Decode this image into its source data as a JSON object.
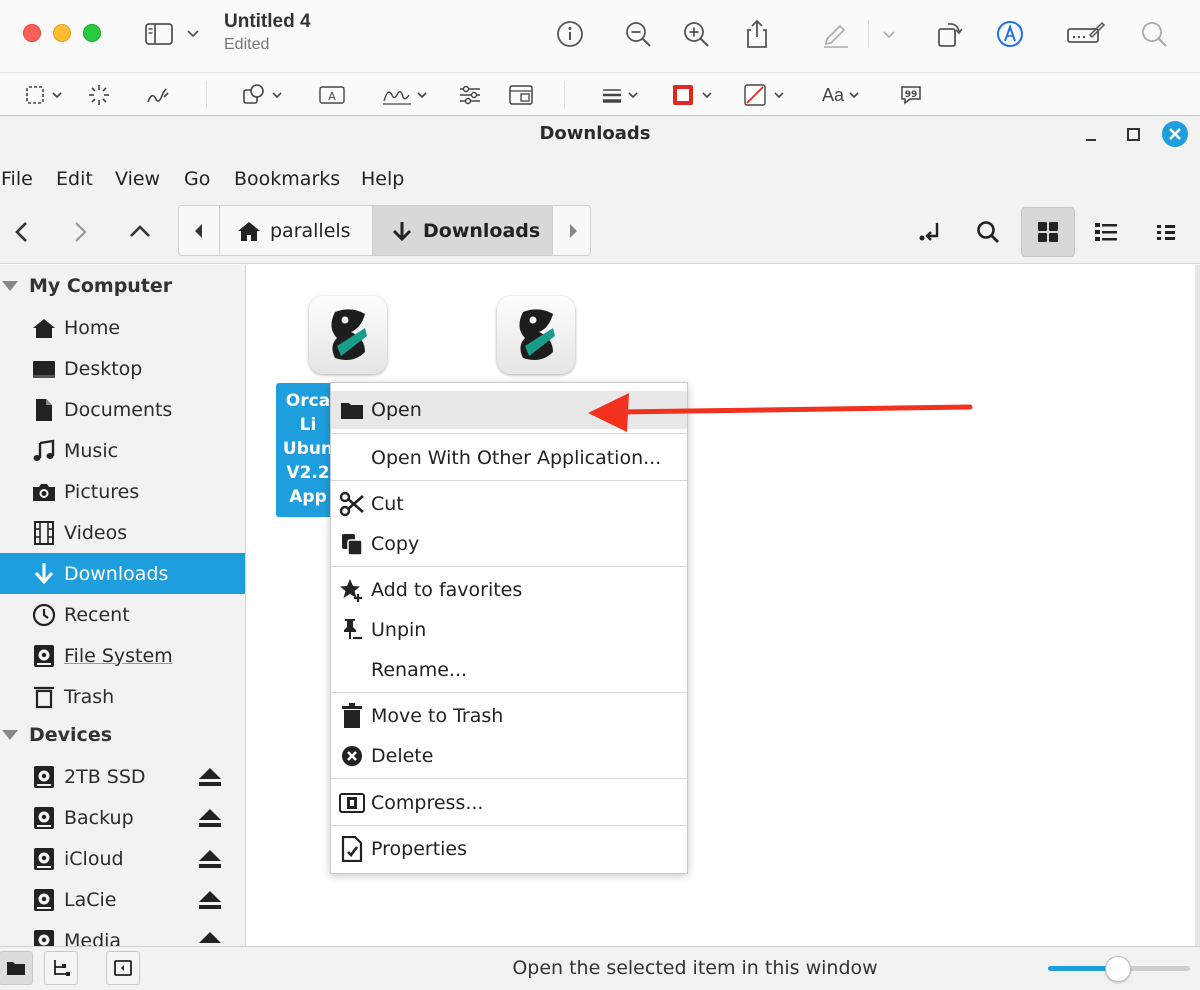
{
  "preview": {
    "document_title": "Untitled 4",
    "document_status": "Edited",
    "toolbar_icons": [
      "info-icon",
      "zoom-out-icon",
      "zoom-in-icon",
      "share-icon",
      "highlight-icon",
      "rotate-icon",
      "markup-icon",
      "form-fill-icon",
      "search-icon"
    ],
    "markup_font_label": "Aa",
    "border_color": "#e0281e"
  },
  "window": {
    "title": "Downloads"
  },
  "menubar": [
    "File",
    "Edit",
    "View",
    "Go",
    "Bookmarks",
    "Help"
  ],
  "breadcrumbs": [
    {
      "label": "parallels",
      "icon": "home-icon"
    },
    {
      "label": "Downloads",
      "icon": "download-icon",
      "active": true
    }
  ],
  "sidebar": {
    "sections": [
      {
        "title": "My Computer",
        "items": [
          {
            "label": "Home",
            "icon": "home-icon"
          },
          {
            "label": "Desktop",
            "icon": "desktop-icon"
          },
          {
            "label": "Documents",
            "icon": "document-icon"
          },
          {
            "label": "Music",
            "icon": "music-icon"
          },
          {
            "label": "Pictures",
            "icon": "camera-icon"
          },
          {
            "label": "Videos",
            "icon": "film-icon"
          },
          {
            "label": "Downloads",
            "icon": "download-icon",
            "selected": true
          },
          {
            "label": "Recent",
            "icon": "clock-icon"
          },
          {
            "label": "File System",
            "icon": "drive-icon"
          },
          {
            "label": "Trash",
            "icon": "trash-icon"
          }
        ]
      },
      {
        "title": "Devices",
        "items": [
          {
            "label": "2TB SSD",
            "icon": "drive-icon",
            "eject": true
          },
          {
            "label": "Backup",
            "icon": "drive-icon",
            "eject": true
          },
          {
            "label": "iCloud",
            "icon": "drive-icon",
            "eject": true
          },
          {
            "label": "LaCie",
            "icon": "drive-icon",
            "eject": true
          },
          {
            "label": "Media",
            "icon": "drive-icon",
            "eject": true
          }
        ]
      }
    ]
  },
  "files": [
    {
      "label": "Orca\nLi\nUbun\nV2.2\nApp",
      "selected": true,
      "icon": "app-icon"
    },
    {
      "label": "",
      "selected": false,
      "icon": "app-icon"
    }
  ],
  "context_menu": [
    {
      "label": "Open",
      "icon": "folder-icon",
      "hover": true
    },
    {
      "label": "Open With Other Application...",
      "icon": ""
    },
    {
      "label": "Cut",
      "icon": "scissors-icon"
    },
    {
      "label": "Copy",
      "icon": "copy-icon"
    },
    {
      "label": "Add to favorites",
      "icon": "star-plus-icon"
    },
    {
      "label": "Unpin",
      "icon": "unpin-icon"
    },
    {
      "label": "Rename...",
      "icon": ""
    },
    {
      "label": "Move to Trash",
      "icon": "trash-icon"
    },
    {
      "label": "Delete",
      "icon": "delete-icon"
    },
    {
      "label": "Compress...",
      "icon": "compress-icon"
    },
    {
      "label": "Properties",
      "icon": "properties-icon"
    }
  ],
  "statusbar": {
    "text": "Open the selected item in this window",
    "zoom_level": 0.49
  },
  "colors": {
    "accent": "#1f9ede",
    "annotation_arrow": "#f2311f"
  }
}
